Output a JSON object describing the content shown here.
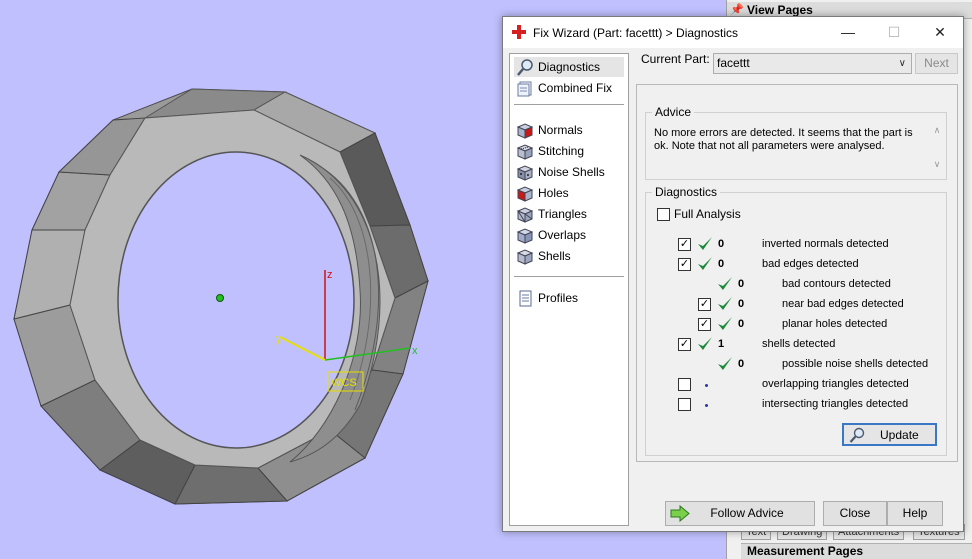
{
  "viewport": {
    "axis_z": "z",
    "axis_y": "y",
    "axis_x": "x",
    "wcs_label": "WCS"
  },
  "right_panel": {
    "title": "View Pages",
    "tabs": [
      "Text",
      "Drawing",
      "Attachments",
      "Textures"
    ],
    "bottom_title": "Measurement Pages"
  },
  "dialog": {
    "title": "Fix Wizard (Part: facettt) > Diagnostics",
    "window_buttons": {
      "minimize": "—",
      "maximize": "☐",
      "close": "✕"
    },
    "nav": [
      {
        "label": "Diagnostics",
        "icon": "magnifier-icon",
        "active": true
      },
      {
        "label": "Combined Fix",
        "icon": "combined-fix-icon"
      },
      {
        "label": "Normals",
        "icon": "normals-cube-icon"
      },
      {
        "label": "Stitching",
        "icon": "stitching-cube-icon"
      },
      {
        "label": "Noise Shells",
        "icon": "noise-shells-cube-icon"
      },
      {
        "label": "Holes",
        "icon": "holes-cube-icon"
      },
      {
        "label": "Triangles",
        "icon": "triangles-cube-icon"
      },
      {
        "label": "Overlaps",
        "icon": "overlaps-cube-icon"
      },
      {
        "label": "Shells",
        "icon": "shells-cube-icon"
      },
      {
        "label": "Profiles",
        "icon": "profiles-doc-icon"
      }
    ],
    "current_part_label": "Current Part:",
    "current_part_value": "facettt",
    "next_label": "Next",
    "advice": {
      "title": "Advice",
      "text": "No more errors are detected. It seems that the part is ok. Note that not all parameters were analysed."
    },
    "diagnostics": {
      "title": "Diagnostics",
      "full_analysis": "Full Analysis",
      "rows": [
        {
          "label": "inverted normals detected",
          "count": "0",
          "checked": true,
          "ok": true
        },
        {
          "label": "bad edges detected",
          "count": "0",
          "checked": true,
          "ok": true
        },
        {
          "label": "bad contours detected",
          "count": "0",
          "ok": true
        },
        {
          "label": "near bad edges detected",
          "count": "0",
          "checked": true,
          "ok": true
        },
        {
          "label": "planar holes detected",
          "count": "0",
          "checked": true,
          "ok": true
        },
        {
          "label": "shells detected",
          "count": "1",
          "checked": true,
          "ok": true
        },
        {
          "label": "possible noise shells detected",
          "count": "0",
          "ok": true
        },
        {
          "label": "overlapping triangles detected",
          "checked": false
        },
        {
          "label": "intersecting triangles detected",
          "checked": false
        }
      ],
      "update_label": "Update"
    },
    "buttons": {
      "follow_advice": "Follow Advice",
      "close": "Close",
      "help": "Help"
    }
  }
}
